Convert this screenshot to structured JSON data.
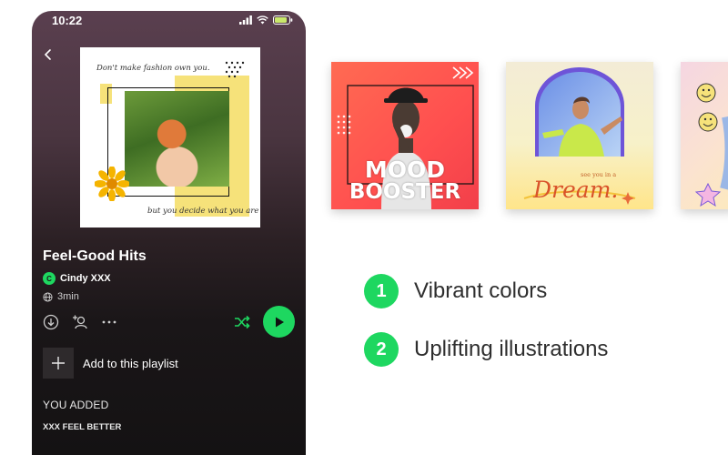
{
  "status_bar": {
    "time": "10:22"
  },
  "playlist": {
    "cover_quote_top": "Don't make fashion own you.",
    "cover_quote_bottom": "but you decide what you are",
    "title": "Feel-Good Hits",
    "owner_initial": "C",
    "owner_name": "Cindy XXX",
    "duration": "3min",
    "add_label": "Add to this playlist",
    "section_label": "YOU ADDED",
    "song_label": "XXX FEEL BETTER"
  },
  "cards": {
    "mood_line1": "MOOD",
    "mood_line2": "BOOSTER",
    "dream_subtitle": "see you in a",
    "dream_word": "Dream."
  },
  "features": [
    {
      "number": "1",
      "text": "Vibrant colors"
    },
    {
      "number": "2",
      "text": "Uplifting illustrations"
    }
  ],
  "colors": {
    "accent": "#1ed760",
    "mood_card": "#ff5a4e",
    "dream_card": "#f7f1c9"
  },
  "icons": [
    "back-arrow-icon",
    "signal-icon",
    "wifi-icon",
    "battery-icon",
    "globe-icon",
    "download-icon",
    "add-user-icon",
    "more-icon",
    "shuffle-icon",
    "play-icon",
    "plus-icon"
  ]
}
